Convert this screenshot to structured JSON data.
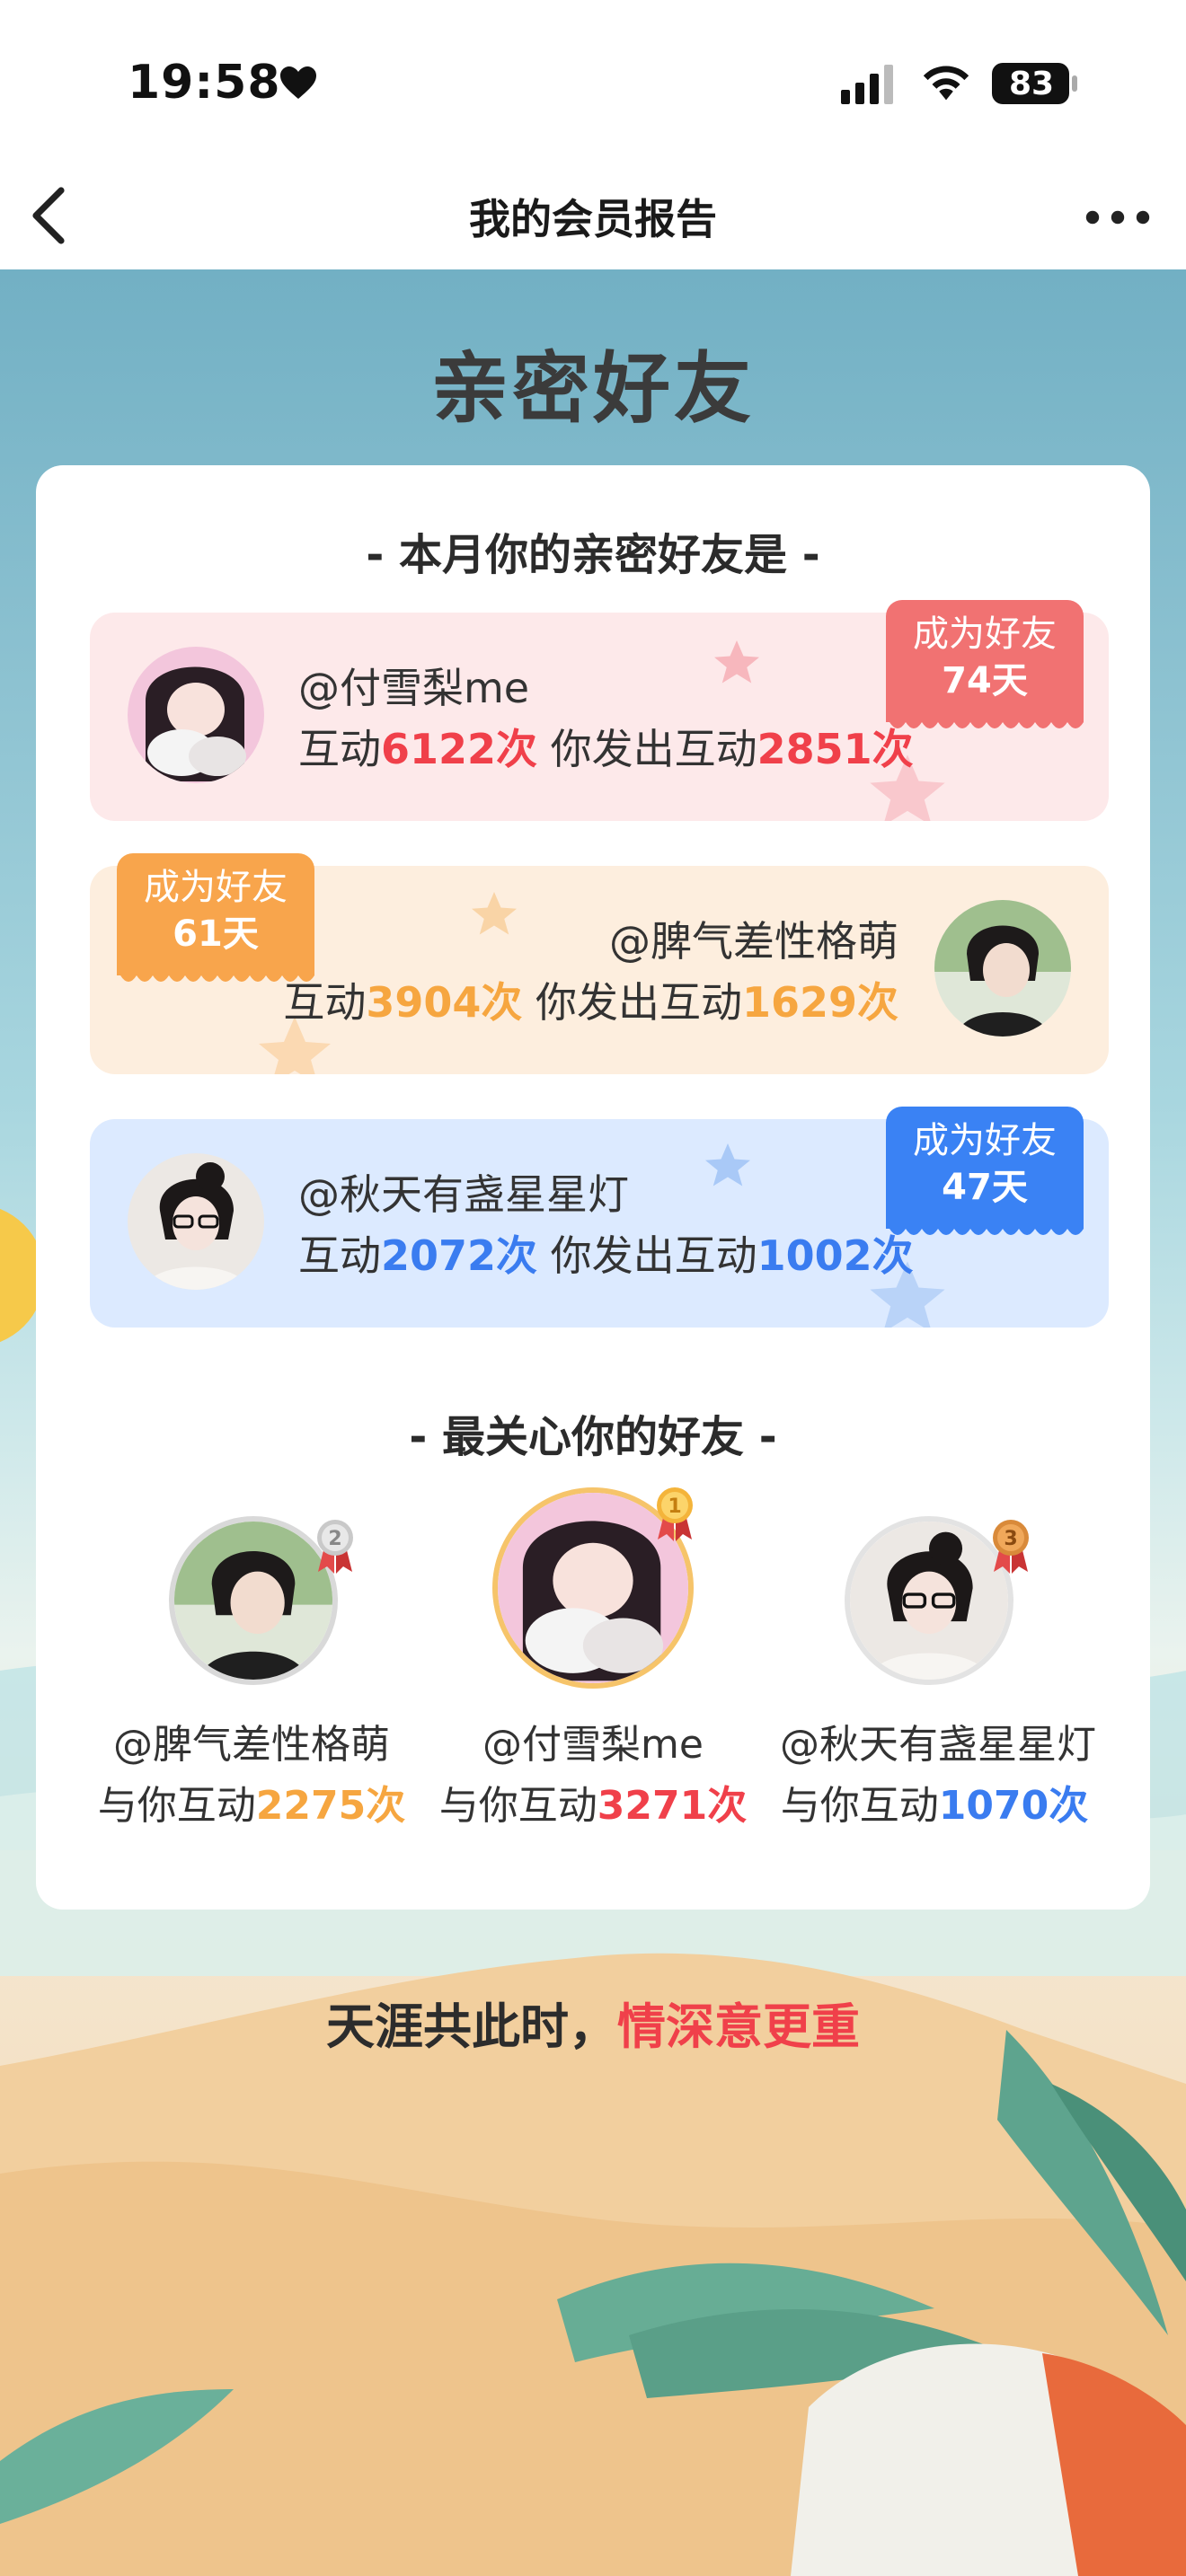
{
  "status_bar": {
    "time": "19:58",
    "battery": "83"
  },
  "nav": {
    "title": "我的会员报告"
  },
  "page_title": "亲密好友",
  "intimate_section": {
    "title": "-  本月你的亲密好友是  -",
    "friends": [
      {
        "name": "@付雪梨me",
        "interact_label": "互动",
        "interact": "6122次",
        "sent_label": "你发出互动",
        "sent": "2851次",
        "badge_top": "成为好友",
        "badge_days": "74天"
      },
      {
        "name": "@脾气差性格萌",
        "interact_label": "互动",
        "interact": "3904次",
        "sent_label": "你发出互动",
        "sent": "1629次",
        "badge_top": "成为好友",
        "badge_days": "61天"
      },
      {
        "name": "@秋天有盏星星灯",
        "interact_label": "互动",
        "interact": "2072次",
        "sent_label": "你发出互动",
        "sent": "1002次",
        "badge_top": "成为好友",
        "badge_days": "47天"
      }
    ]
  },
  "care_section": {
    "title": "-  最关心你的好友  -",
    "friends": [
      {
        "rank": "2",
        "name": "@脾气差性格萌",
        "label": "与你互动",
        "count": "2275次"
      },
      {
        "rank": "1",
        "name": "@付雪梨me",
        "label": "与你互动",
        "count": "3271次"
      },
      {
        "rank": "3",
        "name": "@秋天有盏星星灯",
        "label": "与你互动",
        "count": "1070次"
      }
    ]
  },
  "slogan": {
    "part1": "天涯共此时，",
    "part2": "情深意更重"
  },
  "colors": {
    "red": "#f0404a",
    "orange": "#f6a640",
    "blue": "#3a7cf0"
  }
}
